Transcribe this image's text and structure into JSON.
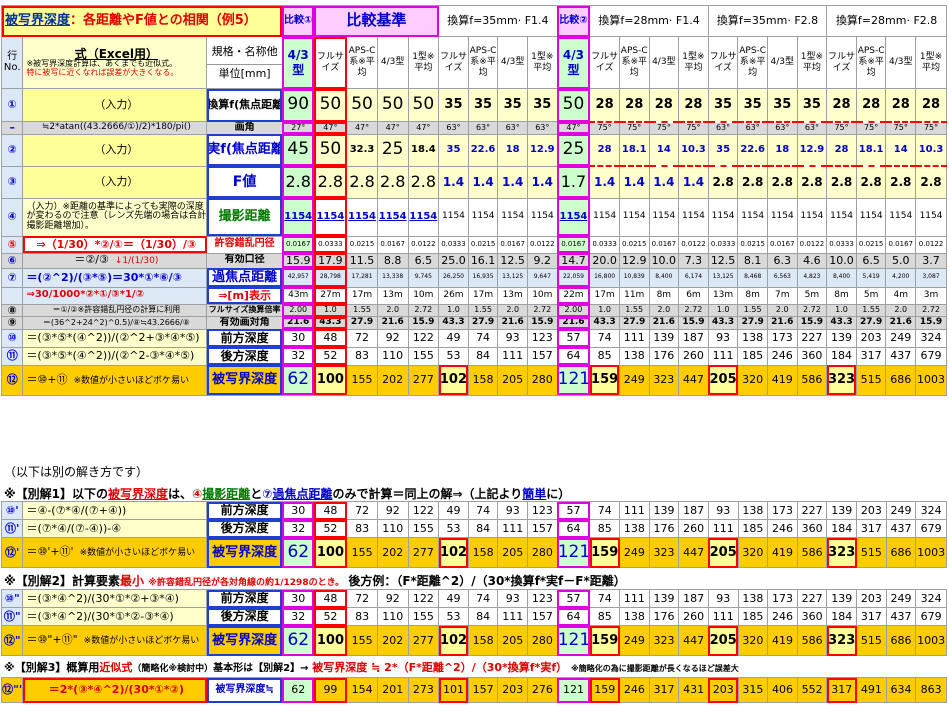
{
  "title": {
    "main": "被写界深度",
    "sub": "：各距離やF値との相関（例5）"
  },
  "top_left_note": {
    "heading": "式（Excel用）",
    "line1": "※被写界深度計算は、あくまでも近似式。",
    "line2": "特に被写に近くなれば誤差が大きくなる。"
  },
  "col_headers": {
    "row_no": "行No.",
    "spec": "規格・名称他",
    "unit": "単位[mm]",
    "cmp1": "比較①",
    "base": "比較基準",
    "g35_14": "換算f=35mm· F1.4",
    "cmp2": "比較②",
    "g28_14": "換算f=28mm· F1.4",
    "g35_28": "換算f=35mm· F2.8",
    "g28_28": "換算f=28mm· F2.8"
  },
  "sub_headers": [
    "4/3型",
    "フルサイズ",
    "APS-C系※平均",
    "4/3型",
    "1型※平均",
    "フルサイズ",
    "APS-C系※平均",
    "4/3型",
    "1型※平均",
    "4/3型",
    "フルサイズ",
    "APS-C系※平均",
    "4/3型",
    "1型※平均",
    "フルサイズ",
    "APS-C系※平均",
    "4/3型",
    "1型※平均",
    "フルサイズ",
    "APS-C系※平均",
    "4/3型",
    "1型※平均"
  ],
  "rows": {
    "r1": {
      "no": "①",
      "formula": "（入力）",
      "spec": "換算f(焦点距離)",
      "vals": [
        "90",
        "50",
        "50",
        "50",
        "50",
        "35",
        "35",
        "35",
        "35",
        "50",
        "28",
        "28",
        "28",
        "28",
        "35",
        "35",
        "35",
        "35",
        "28",
        "28",
        "28",
        "28"
      ]
    },
    "rdash": {
      "no": "–",
      "formula": "≒2*atan((43.2666/①)/2)*180/pi()",
      "spec": "画角",
      "vals": [
        "27°",
        "47°",
        "47°",
        "47°",
        "47°",
        "63°",
        "63°",
        "63°",
        "63°",
        "47°",
        "75°",
        "75°",
        "75°",
        "75°",
        "63°",
        "63°",
        "63°",
        "63°",
        "75°",
        "75°",
        "75°",
        "75°"
      ]
    },
    "r2": {
      "no": "②",
      "formula": "（入力）",
      "spec": "実f(焦点距離)",
      "vals": [
        "45",
        "50",
        "32.3",
        "25",
        "18.4",
        "35",
        "22.6",
        "18",
        "12.9",
        "25",
        "28",
        "18.1",
        "14",
        "10.3",
        "35",
        "22.6",
        "18",
        "12.9",
        "28",
        "18.1",
        "14",
        "10.3"
      ]
    },
    "r3": {
      "no": "③",
      "formula": "（入力）",
      "spec": "F値",
      "vals": [
        "2.8",
        "2.8",
        "2.8",
        "2.8",
        "2.8",
        "1.4",
        "1.4",
        "1.4",
        "1.4",
        "1.7",
        "1.4",
        "1.4",
        "1.4",
        "1.4",
        "2.8",
        "2.8",
        "2.8",
        "2.8",
        "2.8",
        "2.8",
        "2.8",
        "2.8"
      ]
    },
    "r4": {
      "no": "④",
      "formula": "（入力）※距離の基準によっても実際の深度が変わるので注意（レンズ先端の場合は合計撮影距離増加）。",
      "spec": "撮影距離",
      "vals": [
        "1154",
        "1154",
        "1154",
        "1154",
        "1154",
        "1154",
        "1154",
        "1154",
        "1154",
        "1154",
        "1154",
        "1154",
        "1154",
        "1154",
        "1154",
        "1154",
        "1154",
        "1154",
        "1154",
        "1154",
        "1154",
        "1154"
      ]
    },
    "r5": {
      "no": "⑤",
      "formula": "⇒（1/30）*②/①＝（1/30）/③",
      "spec": "許容錯乱円径",
      "vals": [
        "0.0167",
        "0.0333",
        "0.0215",
        "0.0167",
        "0.0122",
        "0.0333",
        "0.0215",
        "0.0167",
        "0.0122",
        "0.0167",
        "0.0333",
        "0.0215",
        "0.0167",
        "0.0122",
        "0.0333",
        "0.0215",
        "0.0167",
        "0.0122",
        "0.0333",
        "0.0215",
        "0.0167",
        "0.0122"
      ]
    },
    "r6": {
      "no": "⑥",
      "formula": "＝②/③",
      "formula2": "↓1/(1/30)",
      "spec": "有効口径",
      "vals": [
        "15.9",
        "17.9",
        "11.5",
        "8.8",
        "6.5",
        "25.0",
        "16.1",
        "12.5",
        "9.2",
        "14.7",
        "20.0",
        "12.9",
        "10.0",
        "7.3",
        "12.5",
        "8.1",
        "6.3",
        "4.6",
        "10.0",
        "6.5",
        "5.0",
        "3.7"
      ]
    },
    "r7": {
      "no": "⑦",
      "formula": "＝(②^2)/(③*⑤)＝30*①*⑥/③",
      "formula2": "⇒30/1000*②*①/③*1/②",
      "spec": "過焦点距離",
      "spec2": "⇒[m]表示",
      "vals": [
        "42,957",
        "28,798",
        "17,281",
        "13,338",
        "9,745",
        "26,250",
        "16,935",
        "13,125",
        "9,647",
        "22,059",
        "16,800",
        "10,839",
        "8,400",
        "6,174",
        "13,125",
        "8,468",
        "6,563",
        "4,823",
        "8,400",
        "5,419",
        "4,200",
        "3,087"
      ],
      "vals_m": [
        "43m",
        "27m",
        "17m",
        "13m",
        "10m",
        "26m",
        "17m",
        "13m",
        "10m",
        "22m",
        "17m",
        "11m",
        "8m",
        "6m",
        "13m",
        "8m",
        "7m",
        "5m",
        "8m",
        "5m",
        "4m",
        "3m"
      ]
    },
    "r8": {
      "no": "⑧",
      "formula": "＝①/②※許容錯乱円径の計算に利用",
      "spec": "フルサイズ換算倍率",
      "vals": [
        "2.00",
        "1.0",
        "1.55",
        "2.0",
        "2.72",
        "1.0",
        "1.55",
        "2.0",
        "2.72",
        "2.00",
        "1.0",
        "1.55",
        "2.0",
        "2.72",
        "1.0",
        "1.55",
        "2.0",
        "2.72",
        "1.0",
        "1.55",
        "2.0",
        "2.72"
      ]
    },
    "r9": {
      "no": "⑨",
      "formula": "＝(36^2+24^2)^0.5)/⑧≒43.2666/⑧",
      "spec": "有効画対角",
      "vals": [
        "21.6",
        "43.3",
        "27.9",
        "21.6",
        "15.9",
        "43.3",
        "27.9",
        "21.6",
        "15.9",
        "21.6",
        "43.3",
        "27.9",
        "21.6",
        "15.9",
        "43.3",
        "27.9",
        "21.6",
        "15.9",
        "43.3",
        "27.9",
        "21.6",
        "15.9"
      ]
    },
    "r10": {
      "no": "⑩",
      "formula": "＝(③*⑤*(④^2))/(②^2+③*④*⑤)",
      "spec": "前方深度",
      "vals": [
        "30",
        "48",
        "72",
        "92",
        "122",
        "49",
        "74",
        "93",
        "123",
        "57",
        "74",
        "111",
        "139",
        "187",
        "93",
        "138",
        "173",
        "227",
        "139",
        "203",
        "249",
        "324"
      ]
    },
    "r11": {
      "no": "⑪",
      "formula": "＝(③*⑤*(④^2))/(②^2-③*④*⑤)",
      "spec": "後方深度",
      "vals": [
        "32",
        "52",
        "83",
        "110",
        "155",
        "53",
        "84",
        "111",
        "157",
        "64",
        "85",
        "138",
        "176",
        "260",
        "111",
        "185",
        "246",
        "360",
        "184",
        "317",
        "437",
        "679"
      ]
    },
    "r12": {
      "no": "⑫",
      "formula": "＝⑩+⑪",
      "formula2": "※数値が小さいほどボケ易い",
      "spec": "被写界深度",
      "vals": [
        "62",
        "100",
        "155",
        "202",
        "277",
        "102",
        "158",
        "205",
        "280",
        "121",
        "159",
        "249",
        "323",
        "447",
        "205",
        "320",
        "419",
        "586",
        "323",
        "515",
        "686",
        "1003"
      ]
    }
  },
  "lower": {
    "intro": "（以下は別の解き方です）",
    "sec1_label": "※【別解1】以下の被写界深度は、④撮影距離と⑦過焦点距離のみで計算＝同上の解⇒（上記より簡単に）",
    "sec1_prefix": "※【別解1】以下の",
    "sec1_dof": "被写界深度",
    "sec1_mid1": "は、",
    "sec1_num4": "④",
    "sec1_dist": "撮影距離",
    "sec1_and": "と",
    "sec1_num7": "⑦",
    "sec1_hyper": "過焦点距離",
    "sec1_tail": "のみで計算＝同上の解⇒（上記より",
    "sec1_easy": "簡単",
    "sec1_end": "に）",
    "s1": [
      {
        "no": "⑩'",
        "formula": "＝④-(⑦*④/(⑦+④))",
        "spec": "前方深度",
        "vals": [
          "30",
          "48",
          "72",
          "92",
          "122",
          "49",
          "74",
          "93",
          "123",
          "57",
          "74",
          "111",
          "139",
          "187",
          "93",
          "138",
          "173",
          "227",
          "139",
          "203",
          "249",
          "324"
        ]
      },
      {
        "no": "⑪'",
        "formula": "＝(⑦*④/(⑦-④))-④",
        "spec": "後方深度",
        "vals": [
          "32",
          "52",
          "83",
          "110",
          "155",
          "53",
          "84",
          "111",
          "157",
          "64",
          "85",
          "138",
          "176",
          "260",
          "111",
          "185",
          "246",
          "360",
          "184",
          "317",
          "437",
          "679"
        ]
      },
      {
        "no": "⑫'",
        "formula": "＝⑩'+⑪'",
        "formula2": "※数値が小さいほどボケ易い",
        "spec": "被写界深度",
        "vals": [
          "62",
          "100",
          "155",
          "202",
          "277",
          "102",
          "158",
          "205",
          "280",
          "121",
          "159",
          "249",
          "323",
          "447",
          "205",
          "320",
          "419",
          "586",
          "323",
          "515",
          "686",
          "1003"
        ]
      }
    ],
    "sec2_prefix": "※【別解2】計算要素",
    "sec2_min": "最小",
    "sec2_note": "※許容錯乱円径が各対角線の約1/1298のとき。",
    "sec2_example": "後方例：（F*距離^2）/（30*換算f*実f－F*距離）",
    "s2": [
      {
        "no": "⑩\"",
        "formula": "＝(③*④^2)/(30*①*②+③*④)",
        "spec": "前方深度",
        "vals": [
          "30",
          "48",
          "72",
          "92",
          "122",
          "49",
          "74",
          "93",
          "123",
          "57",
          "74",
          "111",
          "139",
          "187",
          "93",
          "138",
          "173",
          "227",
          "139",
          "203",
          "249",
          "324"
        ]
      },
      {
        "no": "⑪\"",
        "formula": "＝(③*④^2)/(30*①*②-③*④)",
        "spec": "後方深度",
        "vals": [
          "32",
          "52",
          "83",
          "110",
          "155",
          "53",
          "84",
          "111",
          "157",
          "64",
          "85",
          "138",
          "176",
          "260",
          "111",
          "185",
          "246",
          "360",
          "184",
          "317",
          "437",
          "679"
        ]
      },
      {
        "no": "⑫\"",
        "formula": "＝⑩\"+⑪\"",
        "formula2": "※数値が小さいほどボケ易い",
        "spec": "被写界深度",
        "vals": [
          "62",
          "100",
          "155",
          "202",
          "277",
          "102",
          "158",
          "205",
          "280",
          "121",
          "159",
          "249",
          "323",
          "447",
          "205",
          "320",
          "419",
          "586",
          "323",
          "515",
          "686",
          "1003"
        ]
      }
    ],
    "sec3_prefix": "※【別解3】概算用",
    "sec3_approx": "近似式",
    "sec3_approx_note": "（簡略化※検討中）",
    "sec3_mid": "基本形は【別解2】→",
    "sec3_formula": "被写界深度 ≒ 2*（F*距離^2）/（30*換算f*実f）",
    "sec3_note": "※簡略化の為に撮影距離が長くなるほど誤差大",
    "s3": {
      "no": "⑫\"'",
      "formula": "＝2*(③*④^2)/(30*①*②)",
      "spec": "被写界深度≒",
      "vals": [
        "62",
        "99",
        "154",
        "201",
        "273",
        "101",
        "157",
        "203",
        "276",
        "121",
        "159",
        "246",
        "317",
        "431",
        "203",
        "315",
        "406",
        "552",
        "317",
        "491",
        "634",
        "863"
      ]
    }
  }
}
